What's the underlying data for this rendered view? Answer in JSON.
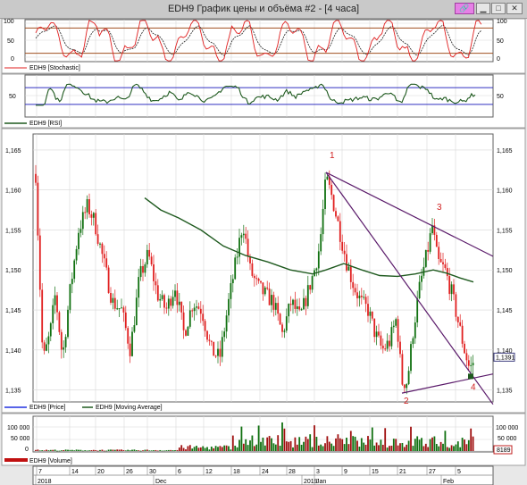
{
  "window": {
    "title": "EDH9 График цены и объёма #2 - [4 часа]",
    "buttons": {
      "link_glyph": "🔗",
      "minimize_glyph": "▁",
      "maximize_glyph": "□",
      "close_glyph": "✕"
    }
  },
  "colors": {
    "price_up": "#107010",
    "price_down": "#e02020",
    "moving_average": "#1f5a1f",
    "trendline": "#5a1a6a",
    "stochastic_main": "#e02020",
    "stochastic_signal": "#202020",
    "stochastic_level": "#a05020",
    "rsi_line": "#1f5a1f",
    "rsi_level": "#3030c0",
    "annotation": "#d02020",
    "volume_up": "#107010",
    "volume_down": "#a01010"
  },
  "stochastic_panel": {
    "legend": "EDH9 [Stochastic]",
    "ticks": [
      "100",
      "50",
      "0"
    ],
    "levels": [
      80,
      20
    ]
  },
  "rsi_panel": {
    "legend": "EDH9 [RSI]",
    "ticks": [
      "50"
    ],
    "levels": [
      70,
      30
    ]
  },
  "price_panel": {
    "legend_price": "EDH9 [Price]",
    "legend_ma": "EDH9 [Moving Average]",
    "ticks": [
      "1,165",
      "1,160",
      "1,155",
      "1,150",
      "1,145",
      "1,140",
      "1,135"
    ],
    "last_price": "1,1391",
    "annotations": [
      "1",
      "2",
      "3",
      "4"
    ]
  },
  "volume_panel": {
    "legend": "EDH9 [Volume]",
    "ticks": [
      "100 000",
      "50 000",
      "0"
    ],
    "last_volume": "8189"
  },
  "time_axis": {
    "day_ticks": [
      "7",
      "14",
      "20",
      "26",
      "30",
      "6",
      "12",
      "18",
      "24",
      "28",
      "3",
      "9",
      "15",
      "21",
      "27",
      "5"
    ],
    "year_labels": [
      "2018",
      "Dec",
      "2019",
      "Jan",
      "Feb"
    ]
  },
  "chart_data": {
    "type": "candlestick",
    "symbol": "EDH9",
    "timeframe": "4 часа",
    "ylim": [
      1.1335,
      1.167
    ],
    "swing_points": [
      {
        "label": "1",
        "price": 1.1622
      },
      {
        "label": "2",
        "price": 1.1346
      },
      {
        "label": "3",
        "price": 1.156
      },
      {
        "label": "4",
        "price": 1.1367
      }
    ],
    "last_price": 1.1391,
    "last_volume": 8189
  }
}
